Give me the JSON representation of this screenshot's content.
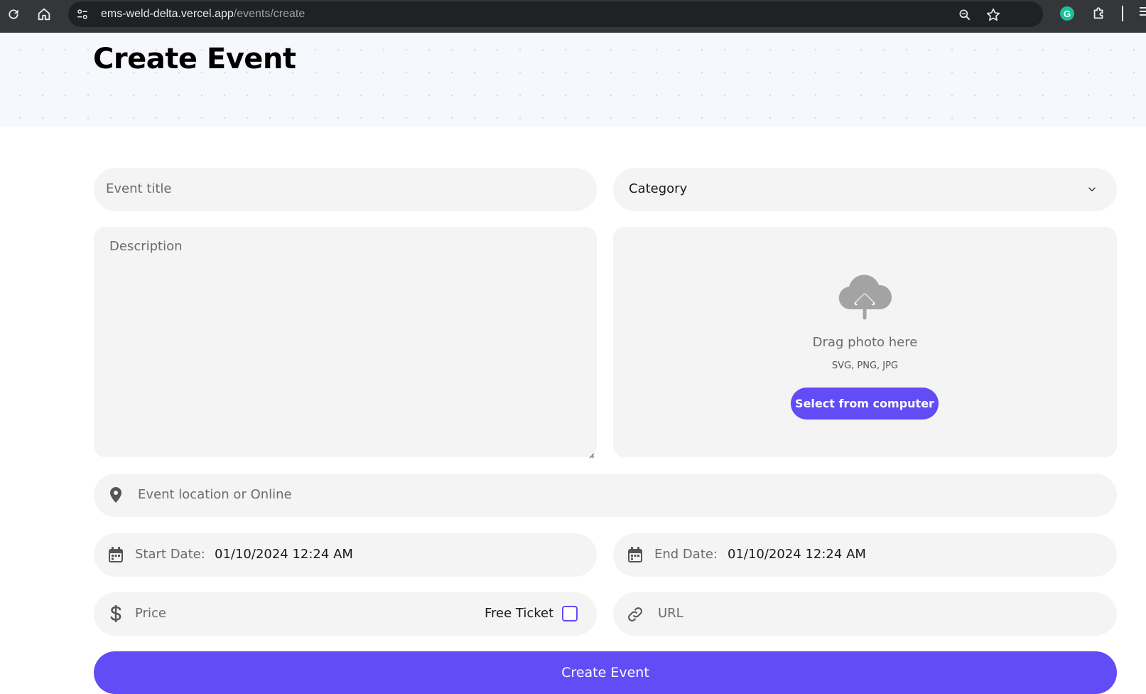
{
  "browser": {
    "url_host": "ems-weld-delta.vercel.app",
    "url_path": "/events/create",
    "grammarly_letter": "G"
  },
  "page": {
    "title": "Create Event"
  },
  "form": {
    "title_placeholder": "Event title",
    "category_selected": "Category",
    "description_placeholder": "Description",
    "upload": {
      "prompt": "Drag photo here",
      "formats": "SVG, PNG, JPG",
      "button_label": "Select from computer"
    },
    "location_placeholder": "Event location or Online",
    "start_date": {
      "label": "Start Date:",
      "value": "01/10/2024 12:24 AM"
    },
    "end_date": {
      "label": "End Date:",
      "value": "01/10/2024 12:24 AM"
    },
    "price_placeholder": "Price",
    "free_ticket_label": "Free Ticket",
    "free_ticket_checked": false,
    "url_placeholder": "URL",
    "submit_label": "Create Event"
  },
  "colors": {
    "accent": "#624cf5",
    "field_bg": "#f4f4f5",
    "hero_bg": "#f6f8fd"
  }
}
